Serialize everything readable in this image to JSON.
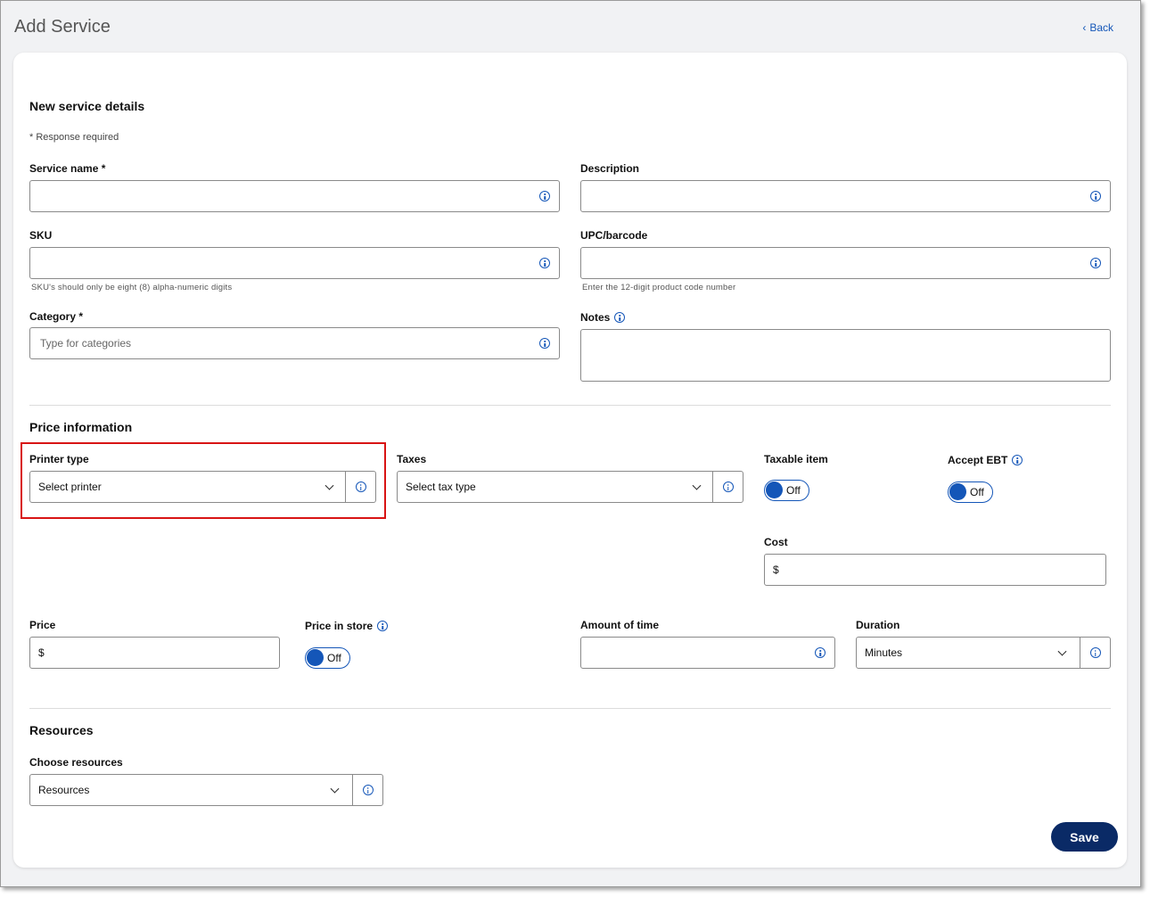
{
  "header": {
    "title": "Add Service",
    "back_label": "Back"
  },
  "details": {
    "section_title": "New service details",
    "required_note": "* Response required",
    "service_name": {
      "label": "Service name *",
      "value": ""
    },
    "description": {
      "label": "Description",
      "value": ""
    },
    "sku": {
      "label": "SKU",
      "value": "",
      "helper": "SKU's should only be eight (8) alpha-numeric digits"
    },
    "upc": {
      "label": "UPC/barcode",
      "value": "",
      "helper": "Enter the 12-digit product code number"
    },
    "category": {
      "label": "Category *",
      "placeholder": "Type for categories"
    },
    "notes": {
      "label": "Notes",
      "value": ""
    }
  },
  "price": {
    "section_title": "Price information",
    "printer_type": {
      "label": "Printer type",
      "selected": "Select printer"
    },
    "taxes": {
      "label": "Taxes",
      "selected": "Select tax type"
    },
    "taxable_item": {
      "label": "Taxable item",
      "state": "Off"
    },
    "accept_ebt": {
      "label": "Accept EBT",
      "state": "Off"
    },
    "cost": {
      "label": "Cost",
      "prefix": "$"
    },
    "price": {
      "label": "Price",
      "prefix": "$"
    },
    "price_in_store": {
      "label": "Price in store",
      "state": "Off"
    },
    "amount_of_time": {
      "label": "Amount of time",
      "value": ""
    },
    "duration": {
      "label": "Duration",
      "selected": "Minutes"
    }
  },
  "resources": {
    "section_title": "Resources",
    "choose": {
      "label": "Choose resources",
      "selected": "Resources"
    }
  },
  "actions": {
    "save_label": "Save"
  },
  "colors": {
    "accent": "#1456b8",
    "save_button": "#0a2a66",
    "highlight": "#d81414"
  }
}
